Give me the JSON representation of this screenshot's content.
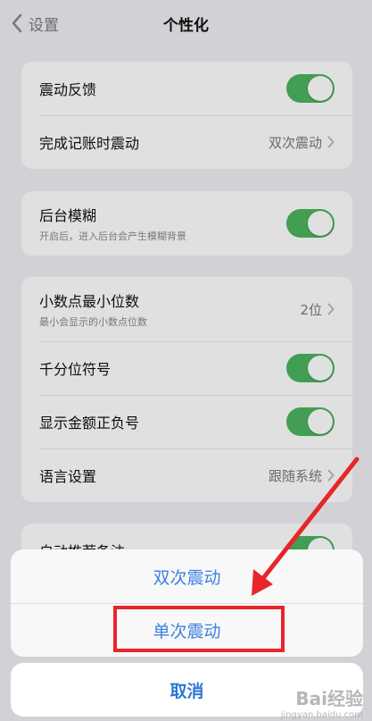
{
  "nav": {
    "back_label": "设置",
    "title": "个性化"
  },
  "group1": {
    "vibration_label": "震动反馈",
    "complete_vibration_label": "完成记账时震动",
    "complete_vibration_value": "双次震动"
  },
  "group2": {
    "blur_label": "后台模糊",
    "blur_sub": "开启后，进入后台会产生模糊背景"
  },
  "group3": {
    "decimal_label": "小数点最小位数",
    "decimal_sub": "最小会显示的小数点位数",
    "decimal_value": "2位",
    "thousands_label": "千分位符号",
    "sign_label": "显示金额正负号",
    "language_label": "语言设置",
    "language_value": "跟随系统"
  },
  "group4": {
    "auto_note_label": "自动推荐备注"
  },
  "sheet": {
    "option_double": "双次震动",
    "option_single": "单次震动",
    "cancel": "取消"
  },
  "watermark": {
    "brand": "Bai经验",
    "url": "jingyan.baidu.com"
  },
  "colors": {
    "switch_on": "#4cb45e",
    "action_blue": "#3d82e0",
    "highlight_red": "#e8252a"
  }
}
